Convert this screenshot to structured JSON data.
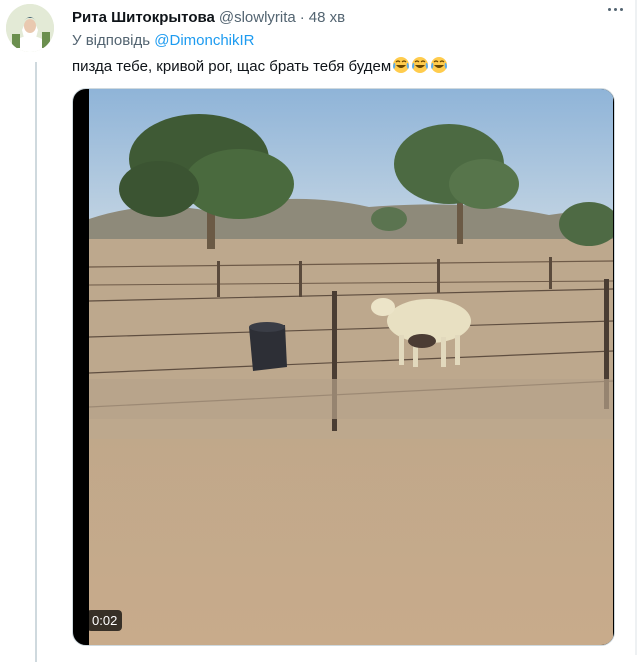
{
  "tweet": {
    "author_name": "Рита Шитокрытова",
    "handle": "@slowlyrita",
    "separator": "·",
    "time": "48 хв",
    "reply_prefix": "У відповідь",
    "reply_mention": "@DimonchikIR",
    "text": "пизда тебе, кривой рог, щас брать тебя будем",
    "emojis": [
      "face-with-tears-of-joy-icon",
      "face-with-tears-of-joy-icon",
      "face-with-tears-of-joy-icon"
    ]
  },
  "media": {
    "duration": "0:02"
  },
  "colors": {
    "accent": "#1d9bf0",
    "secondary_text": "#536471",
    "border": "#cfd9de"
  }
}
